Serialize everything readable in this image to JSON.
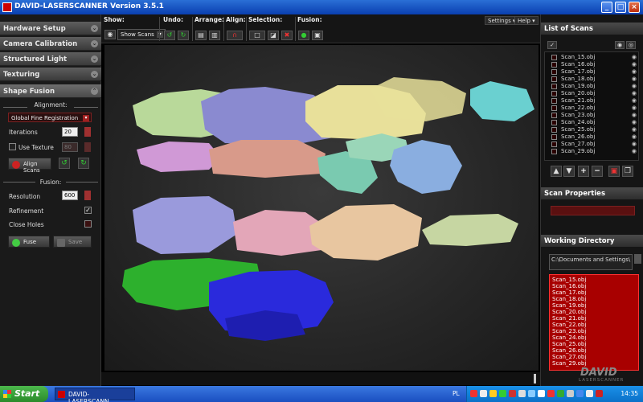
{
  "window": {
    "title": "DAVID-LASERSCANNER Version 3.5.1",
    "minimize": "_",
    "maximize": "□",
    "close": "×"
  },
  "left": {
    "sections": [
      "Hardware Setup",
      "Camera Calibration",
      "Structured Light",
      "Texturing",
      "Shape Fusion"
    ],
    "alignment_label": "Alignment:",
    "method": "Global Fine Registration",
    "iterations_label": "Iterations",
    "iterations": "20",
    "use_texture_label": "Use Texture",
    "texture_value": "80",
    "align_btn": "Align Scans",
    "fusion_label": "Fusion:",
    "resolution_label": "Resolution",
    "resolution": "600",
    "refinement_label": "Refinement",
    "refinement_check": "✓",
    "close_holes_label": "Close Holes",
    "fuse_btn": "Fuse",
    "save_btn": "Save"
  },
  "toolbar": {
    "show_label": "Show:",
    "show_value": "Show Scans",
    "undo_label": "Undo:",
    "arrange_label": "Arrange:",
    "align_label": "Align:",
    "selection_label": "Selection:",
    "fusion_label": "Fusion:",
    "settings_menu": "Settings ▾",
    "help_menu": "Help ▾"
  },
  "right": {
    "list_title": "List of Scans",
    "scans": [
      "Scan_15.obj",
      "Scan_16.obj",
      "Scan_17.obj",
      "Scan_18.obj",
      "Scan_19.obj",
      "Scan_20.obj",
      "Scan_21.obj",
      "Scan_22.obj",
      "Scan_23.obj",
      "Scan_24.obj",
      "Scan_25.obj",
      "Scan_26.obj",
      "Scan_27.obj",
      "Scan_29.obj"
    ],
    "properties_title": "Scan Properties",
    "workdir_title": "Working Directory",
    "workdir_path": "C:\\Documents and Settings\\",
    "files": [
      "Scan_15.obj",
      "Scan_16.obj",
      "Scan_17.obj",
      "Scan_18.obj",
      "Scan_19.obj",
      "Scan_20.obj",
      "Scan_21.obj",
      "Scan_22.obj",
      "Scan_23.obj",
      "Scan_24.obj",
      "Scan_25.obj",
      "Scan_26.obj",
      "Scan_27.obj",
      "Scan_29.obj"
    ],
    "logo": "DAVID",
    "logo_sub": "LASERSCANNER"
  },
  "taskbar": {
    "start": "Start",
    "task": "DAVID-LASERSCANN...",
    "lang": "PL",
    "clock": "14:35"
  },
  "colors": {
    "accent_red": "#a80000",
    "title_blue": "#0a3fb0"
  }
}
